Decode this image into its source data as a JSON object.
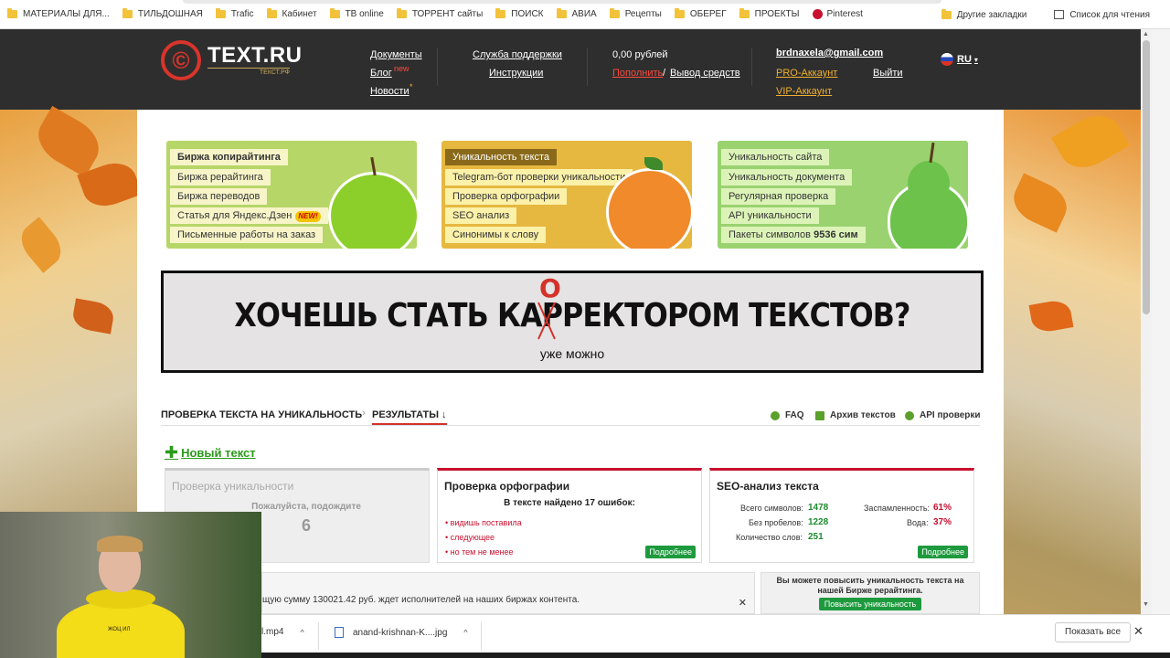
{
  "bookmarks": {
    "items": [
      "МАТЕРИАЛЫ ДЛЯ...",
      "ТИЛЬДОШНАЯ",
      "Trafic",
      "Кабинет",
      "ТВ online",
      "ТОРРЕНТ сайты",
      "ПОИСК",
      "АВИА",
      "Рецепты",
      "ОБЕРЕГ",
      "ПРОЕКТЫ",
      "Pinterest"
    ],
    "other": "Другие закладки",
    "reading_list": "Список для чтения"
  },
  "header": {
    "logo_icon": "©",
    "logo_main": "TEXT.RU",
    "logo_sub": "ТЕКСТ.РФ",
    "docs": "Документы",
    "blog": "Блог",
    "blog_badge": "new",
    "news": "Новости",
    "news_badge": "*",
    "support": "Служба поддержки",
    "instructions": "Инструкции",
    "balance": "0,00 рублей",
    "topup": "Пополнить",
    "slash": "/",
    "withdraw": "Вывод средств",
    "email": "brdnaxela@gmail.com",
    "pro": "PRO-Аккаунт",
    "vip": "VIP-Аккаунт",
    "logout": "Выйти",
    "lang": "RU",
    "lang_caret": "▾"
  },
  "menus": {
    "exchange": [
      "Биржа копирайтинга",
      "Биржа рерайтинга",
      "Биржа переводов",
      "Статья для Яндекс.Дзен",
      "Письменные работы на заказ"
    ],
    "exchange_badge": "NEW!",
    "tools": [
      "Уникальность текста",
      "Telegram-бот проверки уникальности",
      "Проверка орфографии",
      "SEO анализ",
      "Синонимы к слову"
    ],
    "site": [
      "Уникальность сайта",
      "Уникальность документа",
      "Регулярная проверка",
      "API уникальности",
      "Пакеты символов"
    ],
    "symbols_count": "9536 сим"
  },
  "banner": {
    "title": "ХОЧЕШЬ СТАТЬ КАРРЕКТОРОМ ТЕКСТОВ?",
    "fix_letter": "О",
    "subtitle": "уже можно"
  },
  "tabs": {
    "check": "ПРОВЕРКА ТЕКСТА НА УНИКАЛЬНОСТЬ",
    "sep": "›",
    "results": "РЕЗУЛЬТАТЫ ↓",
    "faq": "FAQ",
    "archive": "Архив текстов",
    "api": "API проверки"
  },
  "new_text": {
    "plus": "✚",
    "label": "Новый текст"
  },
  "cards": {
    "uniqueness": {
      "title": "Проверка уникальности",
      "wait": "Пожалуйста, подождите",
      "counter": "6"
    },
    "spelling": {
      "title": "Проверка орфографии",
      "summary": "В тексте найдено 17 ошибок:",
      "errors": [
        "• видишь поставила",
        "• следующее",
        "• но тем не менее"
      ],
      "more": "Подробнее"
    },
    "seo": {
      "title": "SEO-анализ текста",
      "total_label": "Всего символов:",
      "total": "1478",
      "nospace_label": "Без пробелов:",
      "nospace": "1228",
      "words_label": "Количество слов:",
      "words": "251",
      "spam_label": "Заспамленность:",
      "spam": "61%",
      "water_label": "Вода:",
      "water": "37%",
      "more": "Подробнее"
    }
  },
  "bottom": {
    "message": "щую сумму 130021.42 руб. ждет исполнителей на наших биржах контента.",
    "close": "✕",
    "promo": "Вы можете повысить уникальность текста на нашей Бирже рерайтинга.",
    "promo_btn": "Повысить уникальность"
  },
  "video": {
    "hoodie_text": "ЖОЦ ИЛ"
  },
  "downloads": {
    "file1": "l.mp4",
    "file2": "anand-krishnan-K....jpg",
    "chev": "^",
    "show_all": "Показать все",
    "close": "✕"
  },
  "colors": {
    "header_bg": "#2e2e2e",
    "brand_red": "#d9342b",
    "green": "#1e9a3e",
    "accent_red": "#c8102e"
  }
}
